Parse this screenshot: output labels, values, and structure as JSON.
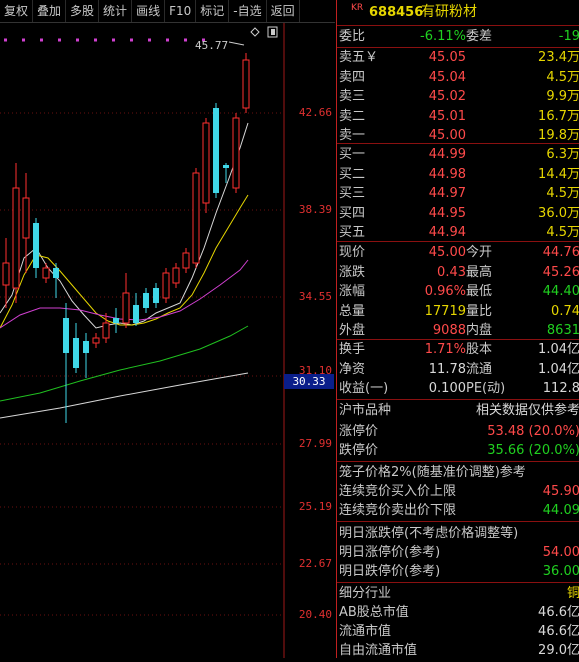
{
  "toolbar": [
    "复权",
    "叠加",
    "多股",
    "统计",
    "画线",
    "F10",
    "标记",
    "-自选",
    "返回"
  ],
  "chart": {
    "price_labels": [
      "42.66",
      "38.39",
      "34.55",
      "31.10",
      "27.99",
      "25.19",
      "22.67",
      "20.40"
    ],
    "current_marker": "30.33",
    "high_annotation": "45.77"
  },
  "panel": {
    "badge": "KR",
    "code": "688456",
    "name": "有研粉材",
    "weibi": {
      "label": "委比",
      "pct": "-6.11%",
      "diff_label": "委差",
      "diff": "-19"
    },
    "asks": [
      {
        "label": "卖五￥",
        "price": "45.05",
        "vol": "23.4万"
      },
      {
        "label": "卖四",
        "price": "45.04",
        "vol": "4.5万"
      },
      {
        "label": "卖三",
        "price": "45.02",
        "vol": "9.9万"
      },
      {
        "label": "卖二",
        "price": "45.01",
        "vol": "16.7万"
      },
      {
        "label": "卖一",
        "price": "45.00",
        "vol": "19.8万"
      }
    ],
    "bids": [
      {
        "label": "买一",
        "price": "44.99",
        "vol": "6.3万"
      },
      {
        "label": "买二",
        "price": "44.98",
        "vol": "14.4万"
      },
      {
        "label": "买三",
        "price": "44.97",
        "vol": "4.5万"
      },
      {
        "label": "买四",
        "price": "44.95",
        "vol": "36.0万"
      },
      {
        "label": "买五",
        "price": "44.94",
        "vol": "4.5万"
      }
    ],
    "stats": [
      {
        "l1": "现价",
        "v1": "45.00",
        "l2": "今开",
        "v2": "44.76"
      },
      {
        "l1": "涨跌",
        "v1": "0.43",
        "l2": "最高",
        "v2": "45.26"
      },
      {
        "l1": "涨幅",
        "v1": "0.96%",
        "l2": "最低",
        "v2": "44.40"
      },
      {
        "l1": "总量",
        "v1": "17719",
        "l2": "量比",
        "v2": "0.74"
      },
      {
        "l1": "外盘",
        "v1": "9088",
        "l2": "内盘",
        "v2": "8631"
      }
    ],
    "stats2": [
      {
        "l1": "换手",
        "v1": "1.71%",
        "l2": "股本",
        "v2": "1.04亿"
      },
      {
        "l1": "净资",
        "v1": "11.78",
        "l2": "流通",
        "v2": "1.04亿"
      },
      {
        "l1": "收益(一)",
        "v1": "0.100",
        "l2": "PE(动)",
        "v2": "112.8"
      }
    ],
    "market": {
      "label": "沪市品种",
      "note": "相关数据仅供参考"
    },
    "limits": [
      {
        "label": "涨停价",
        "value": "53.48 (20.0%)"
      },
      {
        "label": "跌停价",
        "value": "35.66 (20.0%)"
      }
    ],
    "cage": {
      "title": "笼子价格2%(随基准价调整)参考",
      "rows": [
        {
          "label": "连续竞价买入价上限",
          "value": "45.90"
        },
        {
          "label": "连续竞价卖出价下限",
          "value": "44.09"
        }
      ]
    },
    "tomorrow": {
      "title": "明日涨跌停(不考虑价格调整等)",
      "rows": [
        {
          "label": "明日涨停价(参考)",
          "value": "54.00"
        },
        {
          "label": "明日跌停价(参考)",
          "value": "36.00"
        }
      ]
    },
    "industry": [
      {
        "label": "细分行业",
        "value": "铜"
      },
      {
        "label": "AB股总市值",
        "value": "46.6亿"
      },
      {
        "label": "流通市值",
        "value": "46.6亿"
      },
      {
        "label": "自由流通市值",
        "value": "29.0亿"
      }
    ]
  }
}
